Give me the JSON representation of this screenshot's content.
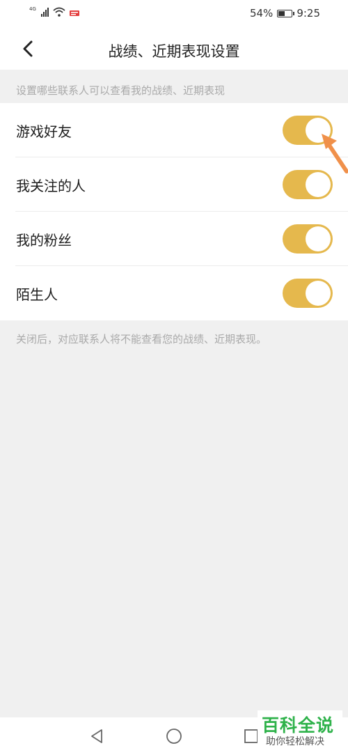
{
  "status_bar": {
    "network_label": "4G",
    "battery_percent": "54%",
    "battery_level": 0.54,
    "time": "9:25"
  },
  "header": {
    "title": "战绩、近期表现设置",
    "back_icon": "chevron-left-icon"
  },
  "section_caption": "设置哪些联系人可以查看我的战绩、近期表现",
  "settings": [
    {
      "label": "游戏好友",
      "on": true
    },
    {
      "label": "我关注的人",
      "on": true
    },
    {
      "label": "我的粉丝",
      "on": true
    },
    {
      "label": "陌生人",
      "on": true
    }
  ],
  "footer_note": "关闭后，对应联系人将不能查看您的战绩、近期表现。",
  "watermark": {
    "title": "百科全说",
    "subtitle": "助你轻松解决"
  },
  "colors": {
    "toggle_on": "#e5b84d",
    "page_bg": "#f0f0f0",
    "arrow": "#f0904a",
    "watermark_green": "#2eb24a"
  }
}
